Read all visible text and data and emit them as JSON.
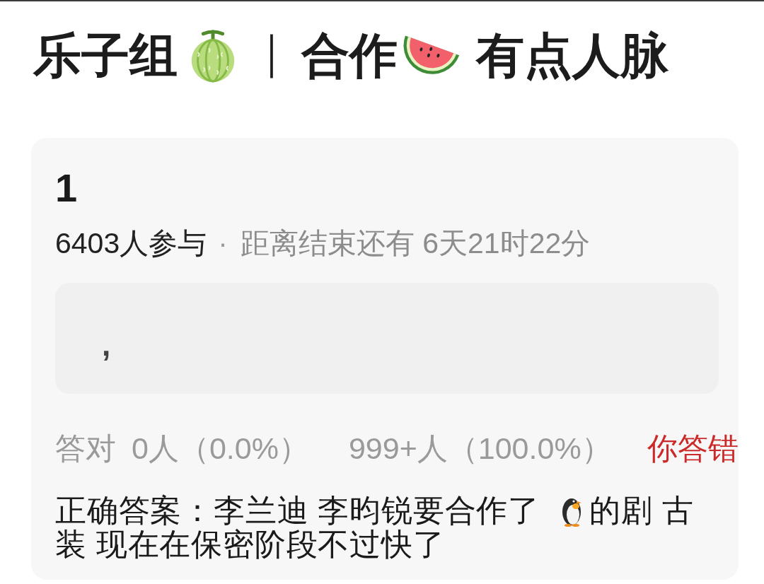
{
  "title": {
    "group": "乐子组",
    "separator": "｜",
    "topic": "合作",
    "tag": "有点人脉"
  },
  "card": {
    "title": "1",
    "participants": "6403人参与",
    "separator": "·",
    "countdown": "距离结束还有 6天21时22分",
    "content": ",",
    "stats": {
      "correct_label": "答对",
      "correct_count": "0人（0.0%）",
      "wrong_count": "999+人（100.0%）",
      "result": "你答错"
    },
    "answer": {
      "line_1_before_icon": "正确答案：李兰迪 李昀锐要合作了",
      "line_1_after_icon": "的剧 古",
      "line_2": "装 现在在保密阶段不过快了"
    }
  }
}
